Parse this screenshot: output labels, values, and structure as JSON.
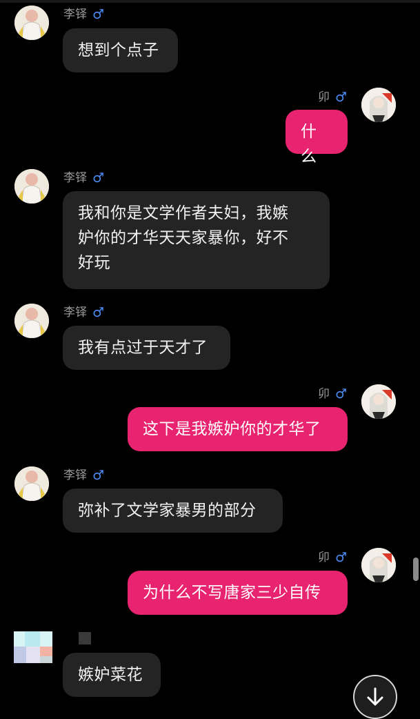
{
  "colors": {
    "background": "#000000",
    "incoming_bubble": "#242424",
    "outgoing_bubble": "#e8236f",
    "gender_icon": "#4c8cf5",
    "name_text": "#9a9a9a"
  },
  "messages": [
    {
      "sender": "李铎",
      "gender": "♂",
      "text": "想到个点子"
    },
    {
      "sender": "卯",
      "gender": "♂",
      "text": "什么"
    },
    {
      "sender": "李铎",
      "gender": "♂",
      "text": "我和你是文学作者夫妇，我嫉\n妒你的才华天天家暴你，好不\n好玩"
    },
    {
      "sender": "李铎",
      "gender": "♂",
      "text": "我有点过于天才了"
    },
    {
      "sender": "卯",
      "gender": "♂",
      "text": "这下是我嫉妒你的才华了"
    },
    {
      "sender": "李铎",
      "gender": "♂",
      "text": "弥补了文学家暴男的部分"
    },
    {
      "sender": "卯",
      "gender": "♂",
      "text": "为什么不写唐家三少自传"
    },
    {
      "sender": "",
      "gender": "",
      "text": "嫉妒菜花"
    }
  ],
  "icons": {
    "scroll_down": "arrow-down-icon",
    "gender": "male-symbol-icon"
  }
}
